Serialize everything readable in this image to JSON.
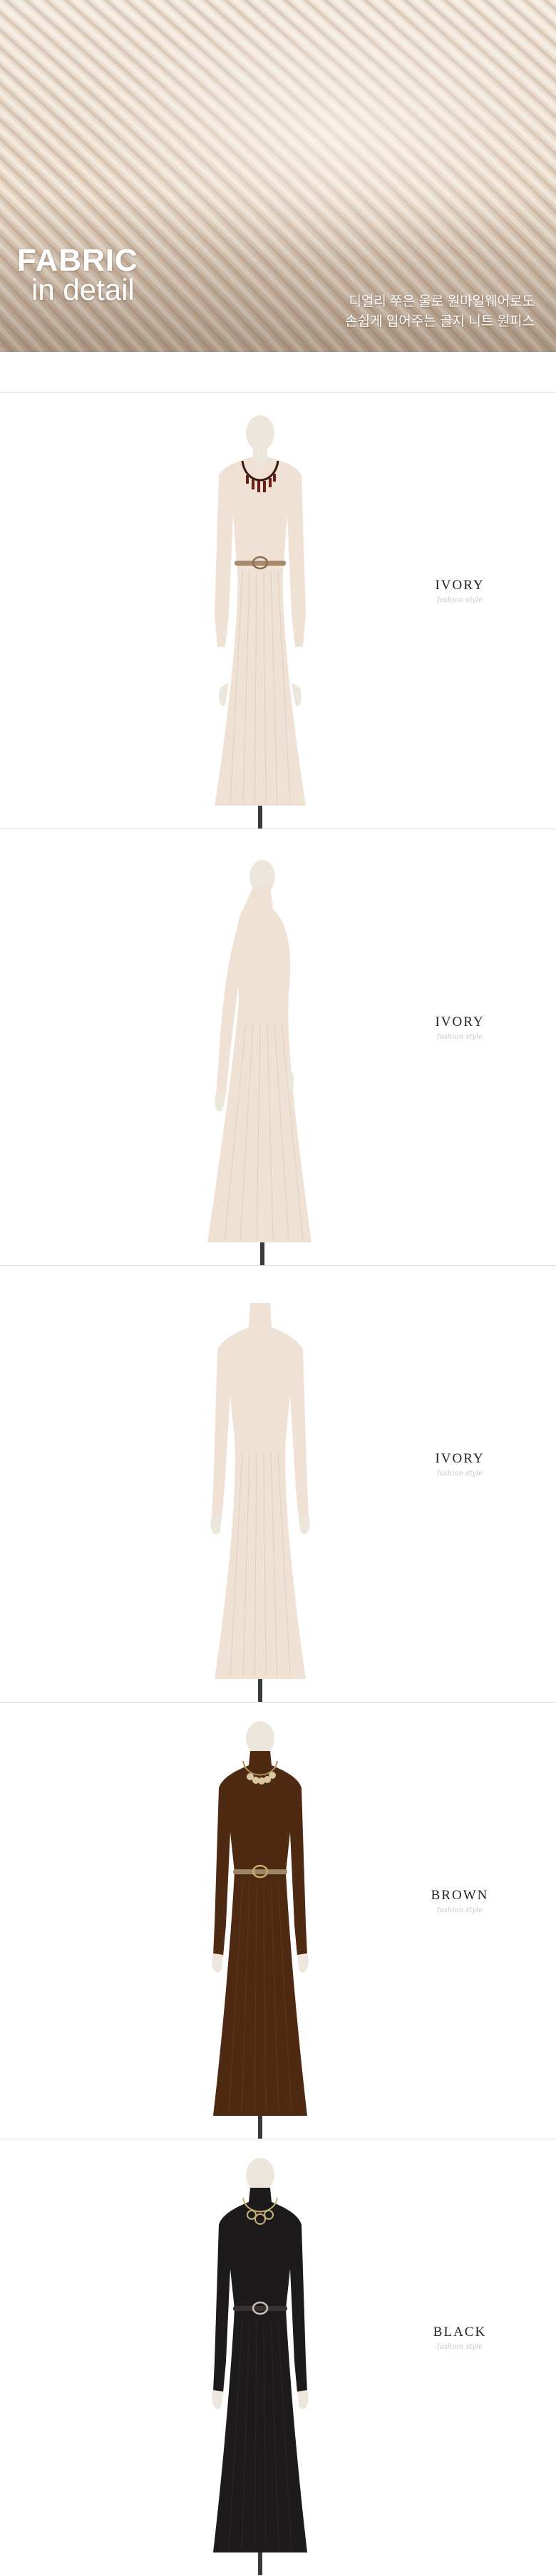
{
  "hero": {
    "title_line1": "FABRIC",
    "title_line2": "in detail",
    "caption_line1": "디얼리 쭈은 울로 원마일웨어로도",
    "caption_line2": "손쉽게 입어주는 골지 니트 원피스",
    "colors": {
      "fabric_light": "#efe4d8",
      "fabric_dark": "#d7c1ab"
    }
  },
  "sections": [
    {
      "color_name": "IVORY",
      "subtitle": "fashion style",
      "dress_color": "#efe2d4",
      "view": "front",
      "accessories": "tassel-necklace-and-belt"
    },
    {
      "color_name": "IVORY",
      "subtitle": "fashion style",
      "dress_color": "#efe2d4",
      "view": "side",
      "accessories": "none"
    },
    {
      "color_name": "IVORY",
      "subtitle": "fashion style",
      "dress_color": "#efe2d4",
      "view": "back",
      "accessories": "none"
    },
    {
      "color_name": "BROWN",
      "subtitle": "fashion style",
      "dress_color": "#4e2a12",
      "view": "front",
      "accessories": "coin-necklace-and-belt"
    },
    {
      "color_name": "BLACK",
      "subtitle": "fashion style",
      "dress_color": "#1c1a1a",
      "view": "front",
      "accessories": "ring-necklace-and-belt"
    }
  ]
}
